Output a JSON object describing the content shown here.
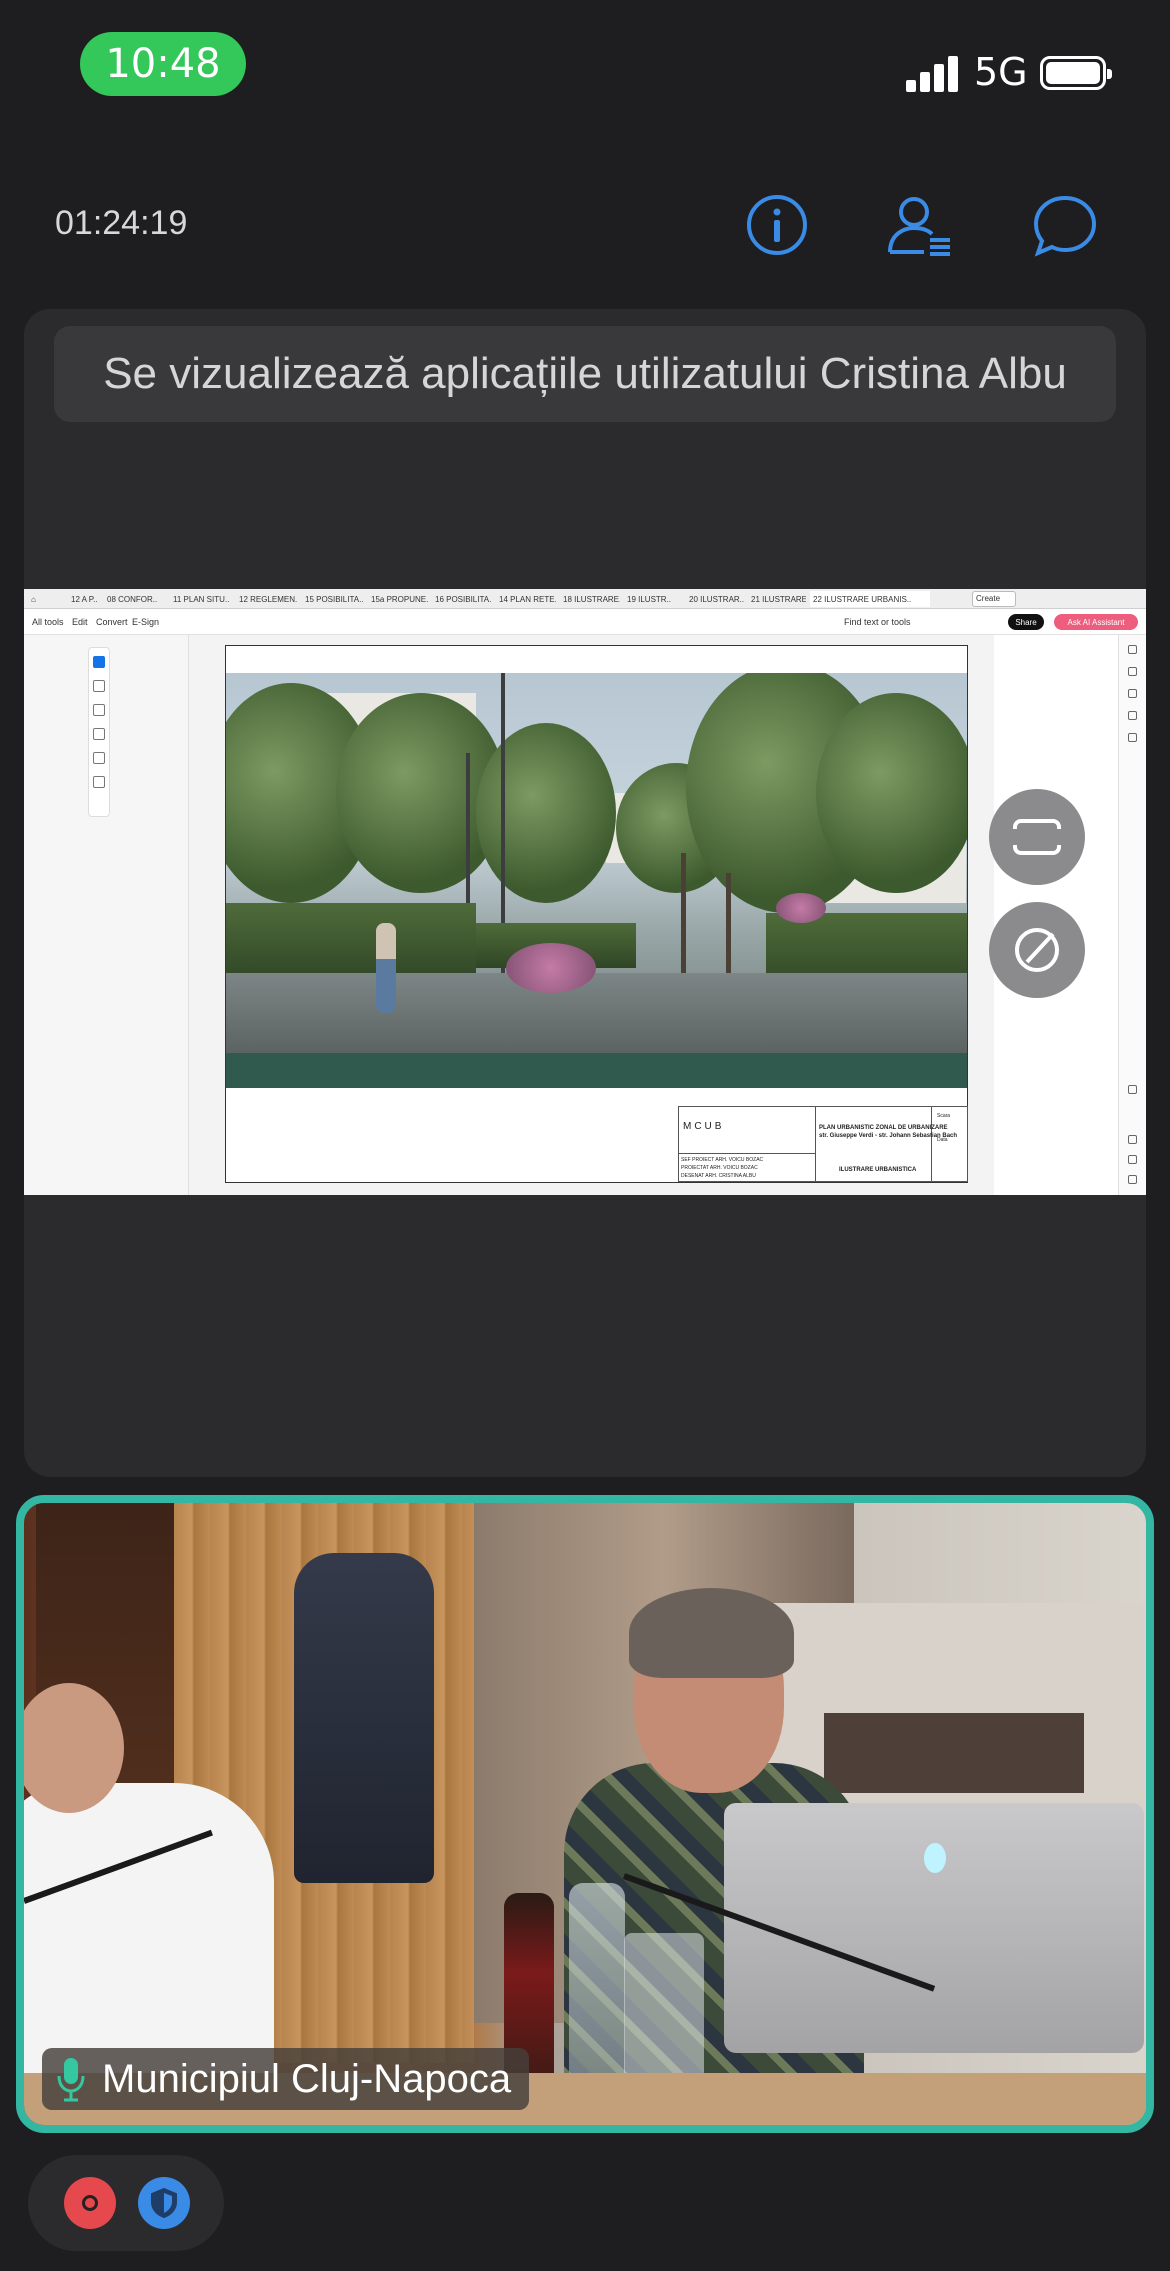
{
  "status_bar": {
    "time": "10:48",
    "network": "5G",
    "time_pill_color": "#34c759"
  },
  "meeting": {
    "elapsed": "01:24:19",
    "icons": [
      "info-icon",
      "participants-icon",
      "chat-icon"
    ],
    "accent_color": "#3a8be6"
  },
  "screen_share": {
    "banner": "Se vizualizează aplicațiile utilizatului Cristina Albu",
    "app": {
      "tabs": [
        "12 A P..",
        "08 CONFOR..",
        "11 PLAN SITU..",
        "12 REGLEMEN..",
        "15 POSIBILITA..",
        "15a PROPUNE..",
        "16 POSIBILITA..",
        "14 PLAN RETE..",
        "18 ILUSTRARE..",
        "19 ILUSTR..",
        "20 ILUSTRAR..",
        "21 ILUSTRARE..",
        "22 ILUSTRARE URBANIS.."
      ],
      "active_tab_index": 12,
      "create_label": "Create",
      "menu": [
        "All tools",
        "Edit",
        "Convert",
        "E-Sign"
      ],
      "find_label": "Find text or tools",
      "share_label": "Share",
      "ai_label": "Ask AI Assistant",
      "ai_color": "#ee5d7d"
    },
    "title_block": {
      "logo": "MCUB",
      "rows": [
        "SEF PROIECT  ARH. VOICU BOZAC",
        "PROIECTAT  ARH. VOICU BOZAC",
        "DESENAT  ARH. CRISTINA ALBU"
      ],
      "plan_title": "PLAN URBANISTIC ZONAL DE URBANIZARE",
      "location": "str. Giuseppe Verdi - str. Johann Sebastian Bach",
      "drawing_title": "ILUSTRARE URBANISTICA",
      "scale": "Scara",
      "date": "Data"
    },
    "float_buttons": [
      "fullscreen-icon",
      "annotate-icon"
    ]
  },
  "video": {
    "participant": "Municipiul Cluj-Napoca",
    "border_color": "#33b7a3"
  },
  "controls": {
    "record_color": "#e5484d",
    "shield_color": "#3a8be6"
  }
}
